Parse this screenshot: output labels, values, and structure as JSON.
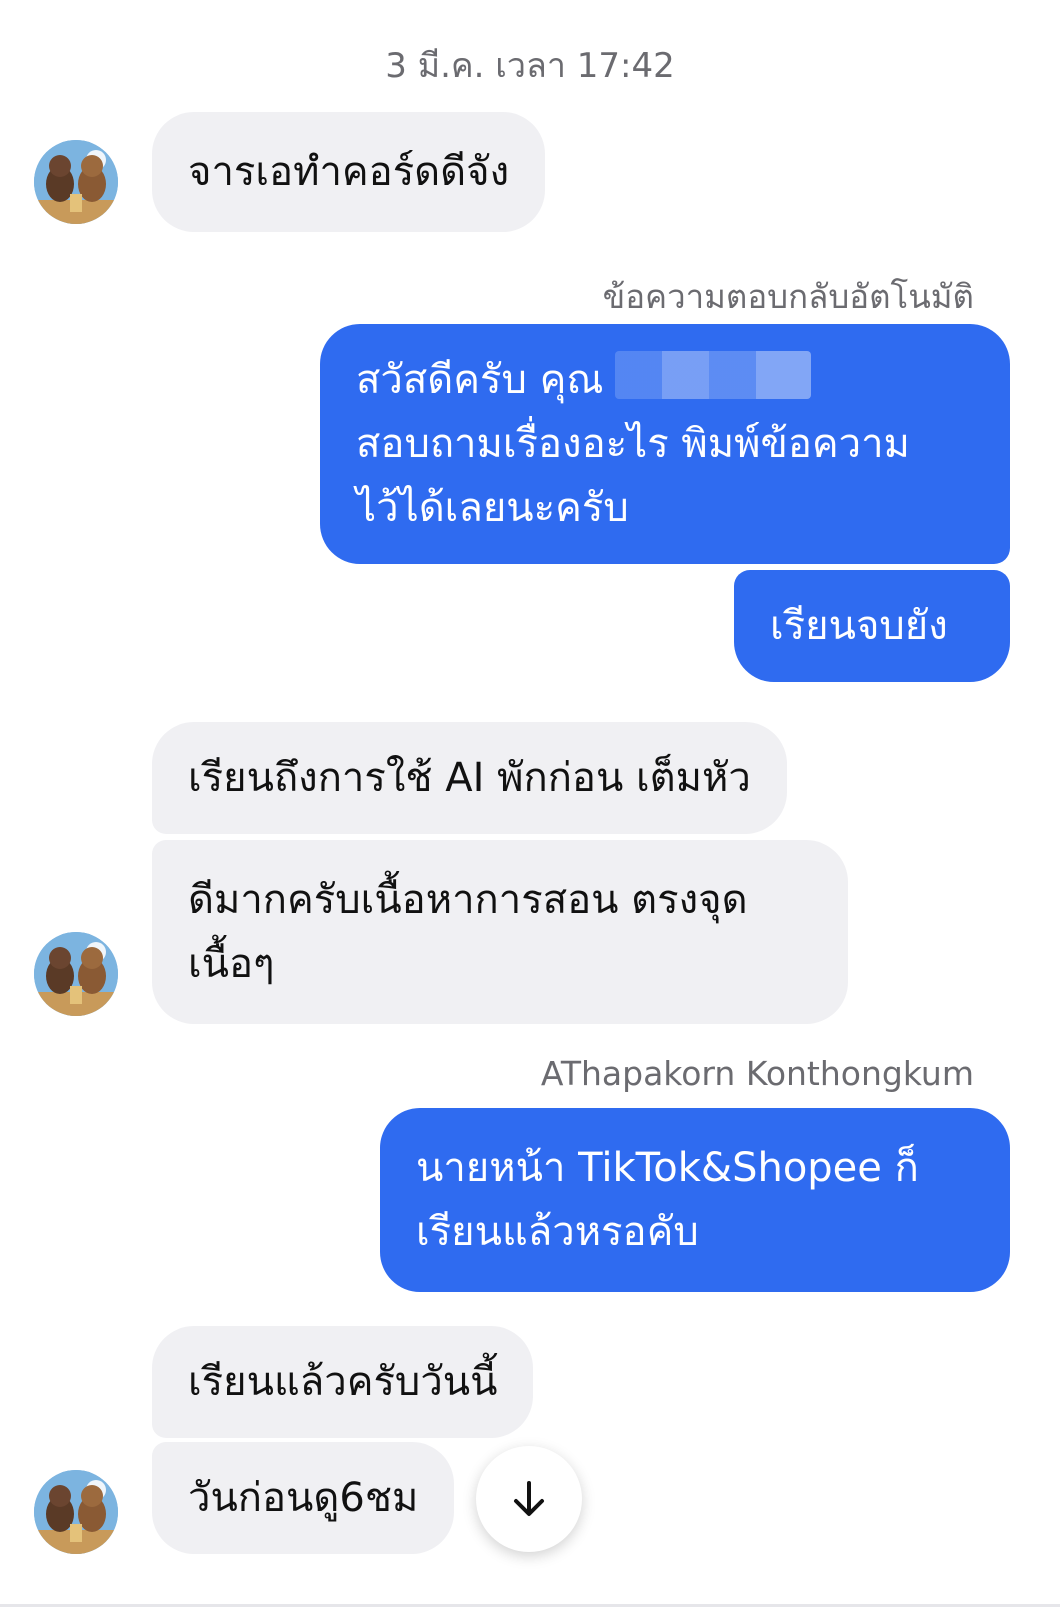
{
  "thread": {
    "timestamp": "3 มี.ค. เวลา 17:42",
    "auto_reply_label": "ข้อความตอบกลับอัตโนมัติ",
    "agent_name_label": "AThapakorn Konthongkum"
  },
  "messages": {
    "m1": "จารเอทำคอร์ดดีจัง",
    "m2_line1": "สวัสดีครับ คุณ",
    "m2_line2": "สอบถามเรื่องอะไร พิมพ์ข้อความ",
    "m2_line3": "ไว้ได้เลยนะครับ",
    "m3": "เรียนจบยัง",
    "m4": "เรียนถึงการใช้ AI พักก่อน เต็มหัว",
    "m5_line1": "ดีมากครับเนื้อหาการสอน ตรงจุด",
    "m5_line2": "เนื้อๆ",
    "m6_line1": "นายหน้า TikTok&Shopee ก็",
    "m6_line2": "เรียนแล้วหรอคับ",
    "m7": "เรียนแล้วครับวันนี้",
    "m8": "วันก่อนดู6ชม"
  },
  "colors": {
    "outgoing_bubble": "#2f6bf0",
    "incoming_bubble": "#f0f0f3",
    "meta_text": "#6b6b70"
  },
  "icons": {
    "avatar": "bears-avatar",
    "scroll": "arrow-down-icon"
  }
}
